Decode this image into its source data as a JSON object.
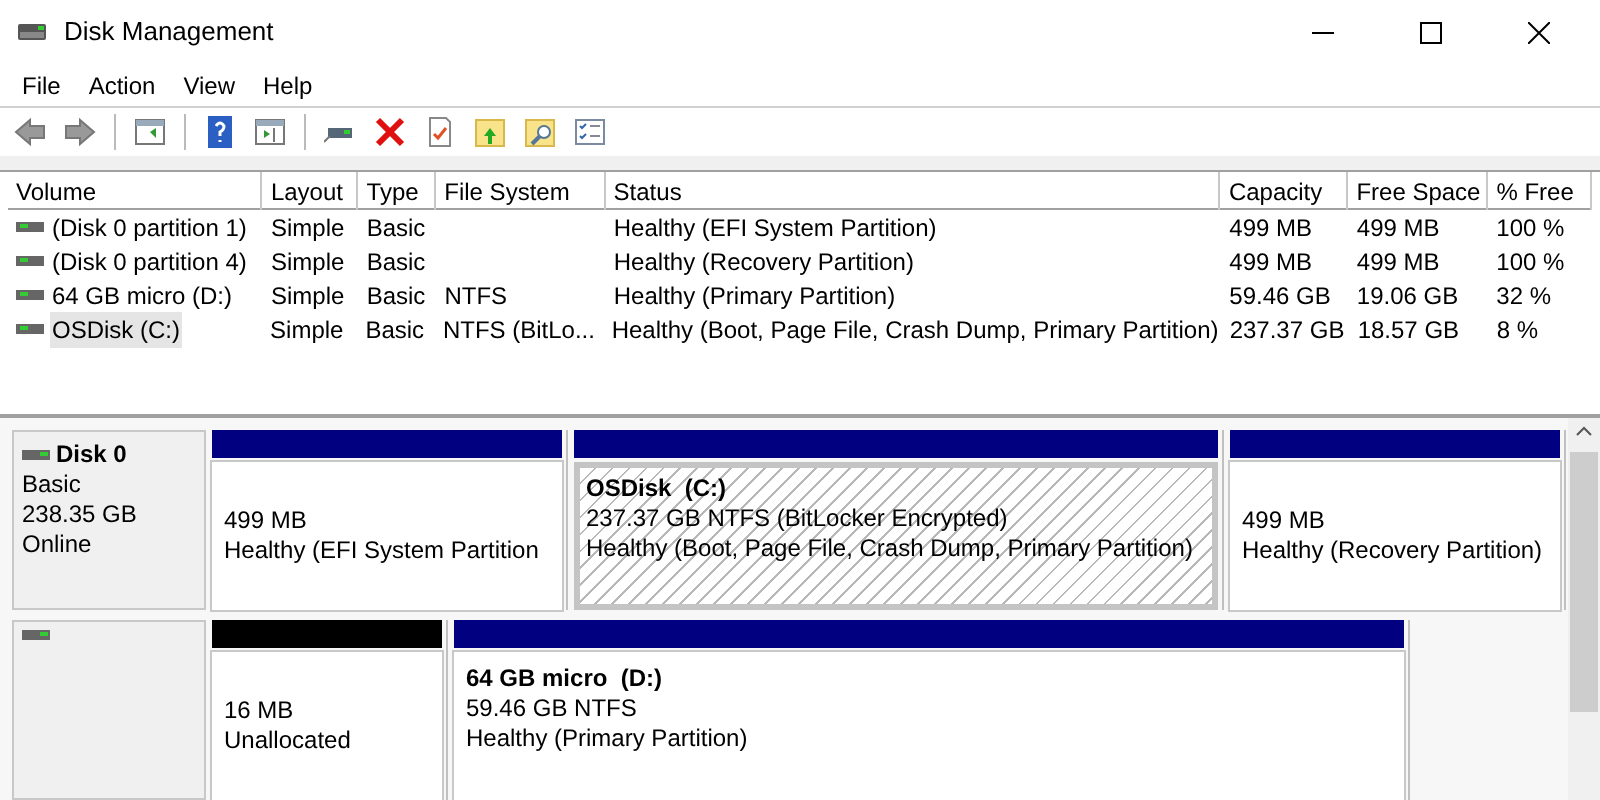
{
  "window": {
    "title": "Disk Management"
  },
  "menu": [
    "File",
    "Action",
    "View",
    "Help"
  ],
  "volume_table": {
    "columns": [
      "Volume",
      "Layout",
      "Type",
      "File System",
      "Status",
      "Capacity",
      "Free Space",
      "% Free"
    ],
    "rows": [
      {
        "cells": [
          "(Disk 0 partition 1)",
          "Simple",
          "Basic",
          "",
          "Healthy (EFI System Partition)",
          "499 MB",
          "499 MB",
          "100 %"
        ],
        "selected": false
      },
      {
        "cells": [
          "(Disk 0 partition 4)",
          "Simple",
          "Basic",
          "",
          "Healthy (Recovery Partition)",
          "499 MB",
          "499 MB",
          "100 %"
        ],
        "selected": false
      },
      {
        "cells": [
          "64 GB micro (D:)",
          "Simple",
          "Basic",
          "NTFS",
          "Healthy (Primary Partition)",
          "59.46 GB",
          "19.06 GB",
          "32 %"
        ],
        "selected": false
      },
      {
        "cells": [
          "OSDisk (C:)",
          "Simple",
          "Basic",
          "NTFS (BitLo...",
          "Healthy (Boot, Page File, Crash Dump, Primary Partition)",
          "237.37 GB",
          "18.57 GB",
          "8 %"
        ],
        "selected": true
      }
    ]
  },
  "disks": [
    {
      "name": "Disk 0",
      "type": "Basic",
      "size": "238.35 GB",
      "status": "Online",
      "partitions": [
        {
          "kind": "primary",
          "selected": false,
          "lines": [
            "499 MB",
            "Healthy (EFI System Partition"
          ]
        },
        {
          "kind": "primary",
          "selected": true,
          "title": "OSDisk  (C:)",
          "lines": [
            "237.37 GB NTFS (BitLocker Encrypted)",
            "Healthy (Boot, Page File, Crash Dump, Primary Partition)"
          ]
        },
        {
          "kind": "primary",
          "selected": false,
          "lines": [
            "499 MB",
            "Healthy (Recovery Partition)"
          ]
        }
      ]
    },
    {
      "partitions": [
        {
          "kind": "unallocated",
          "selected": false,
          "lines": [
            "16 MB",
            "Unallocated"
          ]
        },
        {
          "kind": "primary",
          "selected": false,
          "title": "64 GB micro  (D:)",
          "lines": [
            "59.46 GB NTFS",
            "Healthy (Primary Partition)"
          ]
        }
      ]
    }
  ]
}
